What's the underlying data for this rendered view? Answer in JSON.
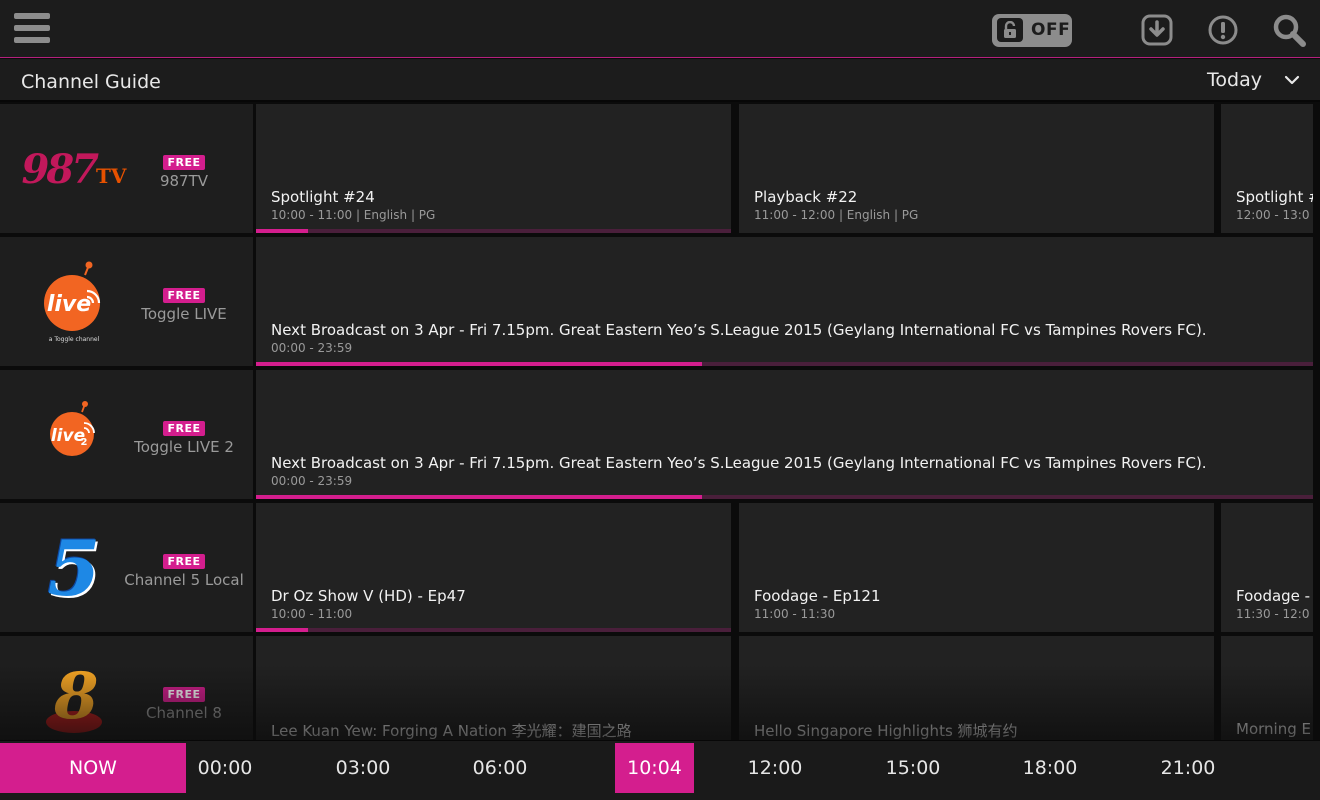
{
  "header": {
    "lock_label": "OFF"
  },
  "subheader": {
    "title": "Channel Guide",
    "day": "Today"
  },
  "colors": {
    "accent": "#d41e8e",
    "background": "#1c1c1c"
  },
  "channels": [
    {
      "logo_text": "987",
      "logo_suffix": "TV",
      "badge": "FREE",
      "name": "987TV",
      "programs": [
        {
          "title": "Spotlight #24",
          "meta": "10:00 - 11:00 | English | PG",
          "progress": 0.11
        },
        {
          "title": "Playback #22",
          "meta": "11:00 - 12:00 | English | PG",
          "progress": 0
        },
        {
          "title": "Spotlight #",
          "meta": "12:00 - 13:0",
          "progress": 0
        }
      ]
    },
    {
      "logo_text": "live",
      "logo_caption": "a Toggle channel",
      "badge": "FREE",
      "name": "Toggle LIVE",
      "programs": [
        {
          "title": "Next Broadcast on 3 Apr - Fri 7.15pm. Great Eastern Yeo’s S.League 2015 (Geylang International FC vs Tampines Rovers FC).",
          "meta": "00:00 - 23:59",
          "progress": 0.422
        }
      ]
    },
    {
      "logo_text": "live",
      "logo_sub": "2",
      "badge": "FREE",
      "name": "Toggle LIVE 2",
      "programs": [
        {
          "title": "Next Broadcast on 3 Apr - Fri 7.15pm. Great Eastern Yeo’s S.League 2015 (Geylang International FC vs Tampines Rovers FC).",
          "meta": "00:00 - 23:59",
          "progress": 0.422
        }
      ]
    },
    {
      "logo_text": "5",
      "badge": "FREE",
      "name": "Channel 5 Local",
      "programs": [
        {
          "title": "Dr Oz Show V (HD) - Ep47",
          "meta": "10:00 - 11:00",
          "progress": 0.11
        },
        {
          "title": "Foodage - Ep121",
          "meta": "11:00 - 11:30",
          "progress": 0
        },
        {
          "title": "Foodage -",
          "meta": "11:30 - 12:0",
          "progress": 0
        }
      ]
    },
    {
      "logo_text": "8",
      "badge": "FREE",
      "name": "Channel 8",
      "programs": [
        {
          "title": "Lee Kuan Yew: Forging A Nation 李光耀：建国之路",
          "meta": "",
          "progress": 0
        },
        {
          "title": "Hello Singapore Highlights 狮城有约",
          "meta": "",
          "progress": 0
        },
        {
          "title": "Morning E",
          "meta": "",
          "progress": 0
        }
      ]
    }
  ],
  "timeline": {
    "now_label": "NOW",
    "current_time": "10:04",
    "ticks": [
      "00:00",
      "03:00",
      "06:00",
      "12:00",
      "15:00",
      "18:00",
      "21:00"
    ]
  }
}
